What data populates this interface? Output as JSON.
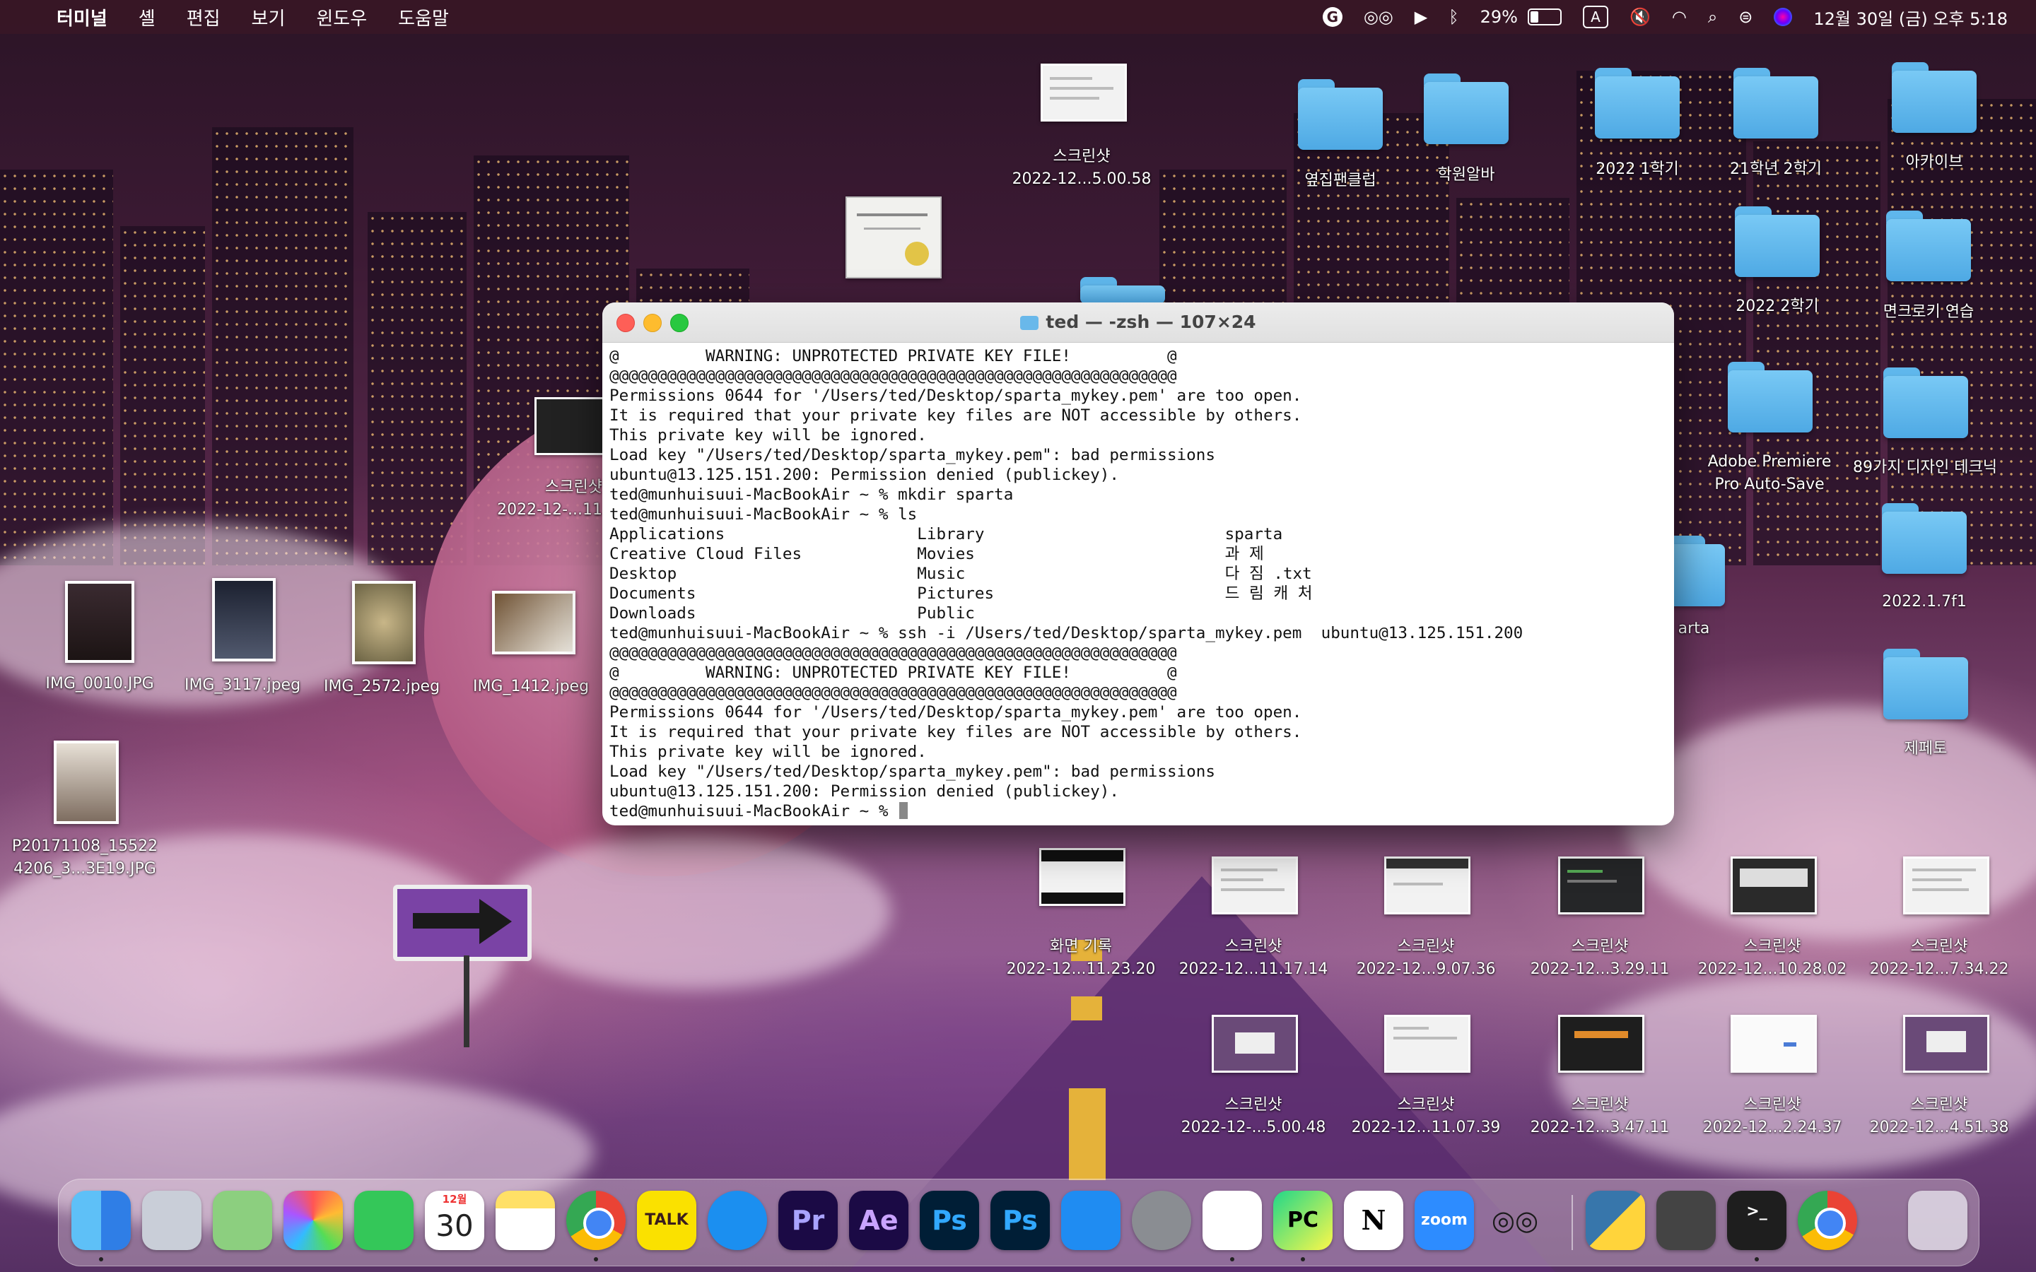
{
  "menubar": {
    "app_name": "터미널",
    "menus": [
      "셸",
      "편집",
      "보기",
      "윈도우",
      "도움말"
    ],
    "battery": "29%",
    "input_source": "A",
    "datetime": "12월 30일 (금) 오후 5:18"
  },
  "desktop": {
    "folders": [
      "옆집팬클럽",
      "학원알바",
      "2022 1학기",
      "21학년 2학기",
      "아카이브",
      "2022 2학기",
      "면크로키 연습",
      "Adobe Premiere Pro Auto-Save",
      "89가지 디자인 테크닉",
      "2022.1.7f1",
      "제페토",
      "arta"
    ],
    "files": {
      "top_screenshot": [
        "스크린샷",
        "2022-12...5.00.58"
      ],
      "left_screenshot": [
        "스크린샷",
        "2022-12-...11"
      ],
      "photos": [
        "IMG_0010.JPG",
        "IMG_3117.jpeg",
        "IMG_2572.jpeg",
        "IMG_1412.jpeg"
      ],
      "photo_portrait": [
        "P20171108_15522",
        "4206_3...3E19.JPG"
      ],
      "row1": [
        [
          "화면 기록",
          "2022-12...11.23.20"
        ],
        [
          "스크린샷",
          "2022-12...11.17.14"
        ],
        [
          "스크린샷",
          "2022-12...9.07.36"
        ],
        [
          "스크린샷",
          "2022-12...3.29.11"
        ],
        [
          "스크린샷",
          "2022-12...10.28.02"
        ],
        [
          "스크린샷",
          "2022-12...7.34.22"
        ]
      ],
      "row2": [
        [
          "스크린샷",
          "2022-12-...5.00.48"
        ],
        [
          "스크린샷",
          "2022-12...11.07.39"
        ],
        [
          "스크린샷",
          "2022-12...3.47.11"
        ],
        [
          "스크린샷",
          "2022-12...2.24.37"
        ],
        [
          "스크린샷",
          "2022-12...4.51.38"
        ]
      ]
    }
  },
  "terminal": {
    "title": "ted — -zsh — 107×24",
    "lines": [
      "@         WARNING: UNPROTECTED PRIVATE KEY FILE!          @",
      "@@@@@@@@@@@@@@@@@@@@@@@@@@@@@@@@@@@@@@@@@@@@@@@@@@@@@@@@@@@",
      "Permissions 0644 for '/Users/ted/Desktop/sparta_mykey.pem' are too open.",
      "It is required that your private key files are NOT accessible by others.",
      "This private key will be ignored.",
      "Load key \"/Users/ted/Desktop/sparta_mykey.pem\": bad permissions",
      "ubuntu@13.125.151.200: Permission denied (publickey).",
      "ted@munhuisuui-MacBookAir ~ % mkdir sparta",
      "ted@munhuisuui-MacBookAir ~ % ls",
      "Applications                    Library                         sparta",
      "Creative Cloud Files            Movies                          과 제",
      "Desktop                         Music                           다 짐 .txt",
      "Documents                       Pictures                        드 림 캐 처",
      "Downloads                       Public",
      "ted@munhuisuui-MacBookAir ~ % ssh -i /Users/ted/Desktop/sparta_mykey.pem  ubuntu@13.125.151.200",
      "@@@@@@@@@@@@@@@@@@@@@@@@@@@@@@@@@@@@@@@@@@@@@@@@@@@@@@@@@@@",
      "@         WARNING: UNPROTECTED PRIVATE KEY FILE!          @",
      "@@@@@@@@@@@@@@@@@@@@@@@@@@@@@@@@@@@@@@@@@@@@@@@@@@@@@@@@@@@",
      "Permissions 0644 for '/Users/ted/Desktop/sparta_mykey.pem' are too open.",
      "It is required that your private key files are NOT accessible by others.",
      "This private key will be ignored.",
      "Load key \"/Users/ted/Desktop/sparta_mykey.pem\": bad permissions",
      "ubuntu@13.125.151.200: Permission denied (publickey).",
      "ted@munhuisuui-MacBookAir ~ % "
    ]
  },
  "dock": {
    "calendar_month": "12월",
    "calendar_day": "30",
    "kakao": "TALK",
    "premiere": "Pr",
    "after_effects": "Ae",
    "photoshop": "Ps",
    "photoshop2": "Ps",
    "pycharm": "PC",
    "notion": "N",
    "zoom": "zoom"
  }
}
